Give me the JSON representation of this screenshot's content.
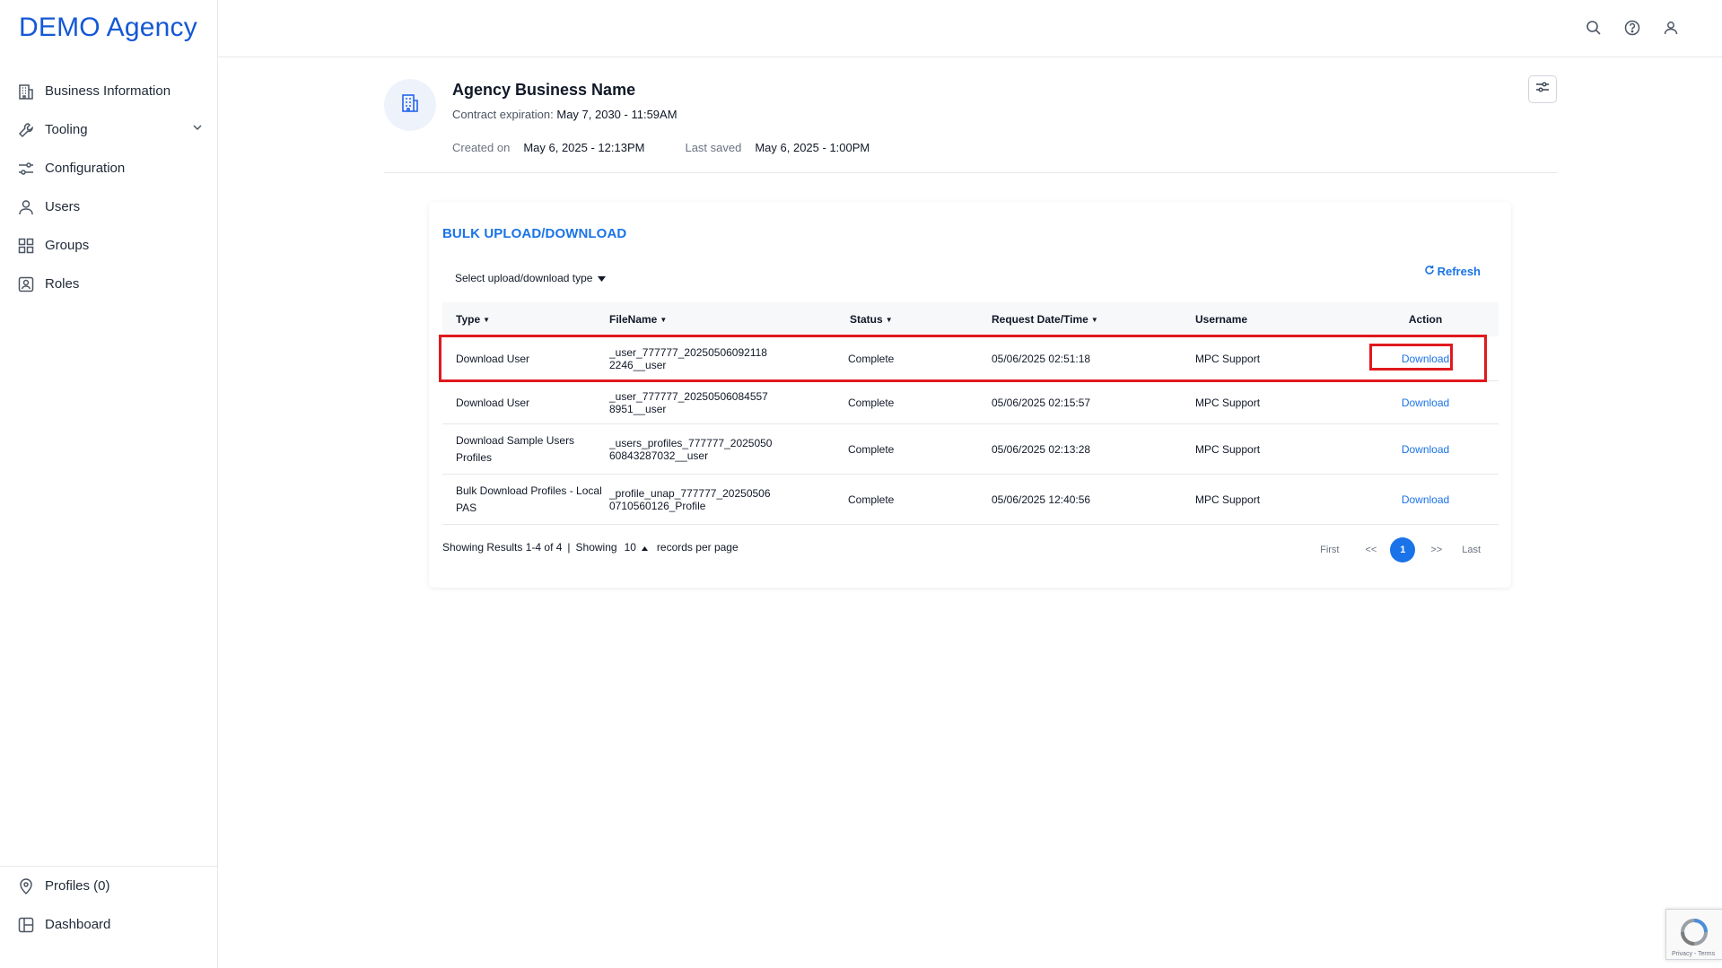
{
  "brand": "DEMO Agency",
  "sidebar": {
    "items": [
      {
        "label": "Business Information",
        "icon": "building-icon"
      },
      {
        "label": "Tooling",
        "icon": "wrench-icon"
      },
      {
        "label": "Configuration",
        "icon": "sliders-icon"
      },
      {
        "label": "Users",
        "icon": "user-icon"
      },
      {
        "label": "Groups",
        "icon": "grid-icon"
      },
      {
        "label": "Roles",
        "icon": "id-badge-icon"
      }
    ],
    "bottom": [
      {
        "label": "Profiles (0)",
        "icon": "location-pin-icon"
      },
      {
        "label": "Dashboard",
        "icon": "dashboard-icon"
      }
    ]
  },
  "header": {
    "agency_name": "Agency Business Name",
    "contract_label": "Contract expiration:",
    "contract_value": "May 7, 2030 - 11:59AM",
    "created_label": "Created on",
    "created_value": "May 6, 2025 - 12:13PM",
    "saved_label": "Last saved",
    "saved_value": "May 6, 2025 - 1:00PM"
  },
  "card": {
    "title": "BULK UPLOAD/DOWNLOAD",
    "select_label": "Select upload/download type",
    "refresh_label": "Refresh"
  },
  "table": {
    "headers": {
      "type": "Type",
      "filename": "FileName",
      "status": "Status",
      "date": "Request Date/Time",
      "username": "Username",
      "action": "Action"
    },
    "rows": [
      {
        "type": [
          "Download User"
        ],
        "file": [
          "_user_777777_20250506092118",
          "2246__user"
        ],
        "status": "Complete",
        "date": "05/06/2025 02:51:18",
        "user": "MPC Support",
        "action": "Download"
      },
      {
        "type": [
          "Download User"
        ],
        "file": [
          "_user_777777_20250506084557",
          "8951__user"
        ],
        "status": "Complete",
        "date": "05/06/2025 02:15:57",
        "user": "MPC Support",
        "action": "Download"
      },
      {
        "type": [
          "Download Sample Users",
          "Profiles"
        ],
        "file": [
          "_users_profiles_777777_2025050",
          "60843287032__user"
        ],
        "status": "Complete",
        "date": "05/06/2025 02:13:28",
        "user": "MPC Support",
        "action": "Download"
      },
      {
        "type": [
          "Bulk Download Profiles - Local",
          "PAS"
        ],
        "file": [
          "_profile_unap_777777_20250506",
          "0710560126_Profile"
        ],
        "status": "Complete",
        "date": "05/06/2025 12:40:56",
        "user": "MPC Support",
        "action": "Download"
      }
    ]
  },
  "footer": {
    "results": "Showing Results 1-4 of 4",
    "sep": "|",
    "showing": "Showing",
    "per_page_value": "10",
    "per_page_suffix": "records per page"
  },
  "pager": {
    "first": "First",
    "prev": "<<",
    "current": "1",
    "next": ">>",
    "last": "Last"
  },
  "recaptcha": {
    "links": "Privacy - Terms"
  },
  "colors": {
    "brand": "#1458d6",
    "accent": "#1a73e8",
    "highlight": "#e0191e"
  }
}
